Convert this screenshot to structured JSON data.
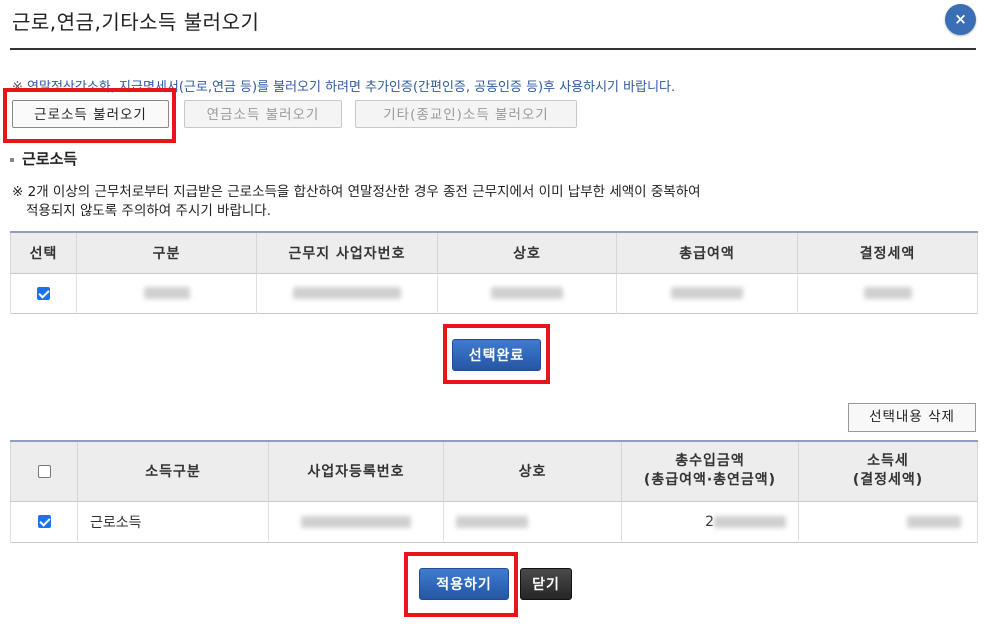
{
  "dialog": {
    "title": "근로,연금,기타소득 불러오기",
    "close_label": "×"
  },
  "notice": {
    "mark": "※",
    "text": " 연말정산간소화, 지급명세서(근로,연금 등)를 불러오기 하려면 추가인증(간편인증, 공동인증 등)후 사용하시기 바랍니다."
  },
  "load_buttons": {
    "earned": "근로소득 불러오기",
    "pension": "연금소득 불러오기",
    "other": "기타(종교인)소득 불러오기"
  },
  "section": {
    "title": "근로소득",
    "desc_line1": "※ 2개 이상의 근무처로부터 지급받은 근로소득을 합산하여 연말정산한 경우 종전 근무지에서 이미 납부한 세액이 중복하여",
    "desc_line2": "적용되지 않도록 주의하여 주시기 바랍니다."
  },
  "top_table": {
    "headers": [
      "선택",
      "구분",
      "근무지 사업자번호",
      "상호",
      "총급여액",
      "결정세액"
    ],
    "rows": [
      {
        "checked": true,
        "type": "",
        "bizno": "",
        "name": "",
        "total": "",
        "tax": ""
      }
    ]
  },
  "select_done_label": "선택완료",
  "delete_selected_label": "선택내용 삭제",
  "bottom_table": {
    "headers": {
      "type": "소득구분",
      "bizno": "사업자등록번호",
      "name": "상호",
      "total_line1": "총수입금액",
      "total_line2": "(총급여액·총연금액)",
      "tax_line1": "소득세",
      "tax_line2": "(결정세액)"
    },
    "rows": [
      {
        "checked": true,
        "type": "근로소득",
        "bizno": "",
        "name": "",
        "total_prefix": "2",
        "tax": ""
      }
    ]
  },
  "footer": {
    "apply_label": "적용하기",
    "close_label": "닫기"
  },
  "colors": {
    "highlight": "#e8141b",
    "primary_button": "#2f66b8",
    "close_circle": "#3a6fb6",
    "notice_text": "#2f5aa0"
  }
}
